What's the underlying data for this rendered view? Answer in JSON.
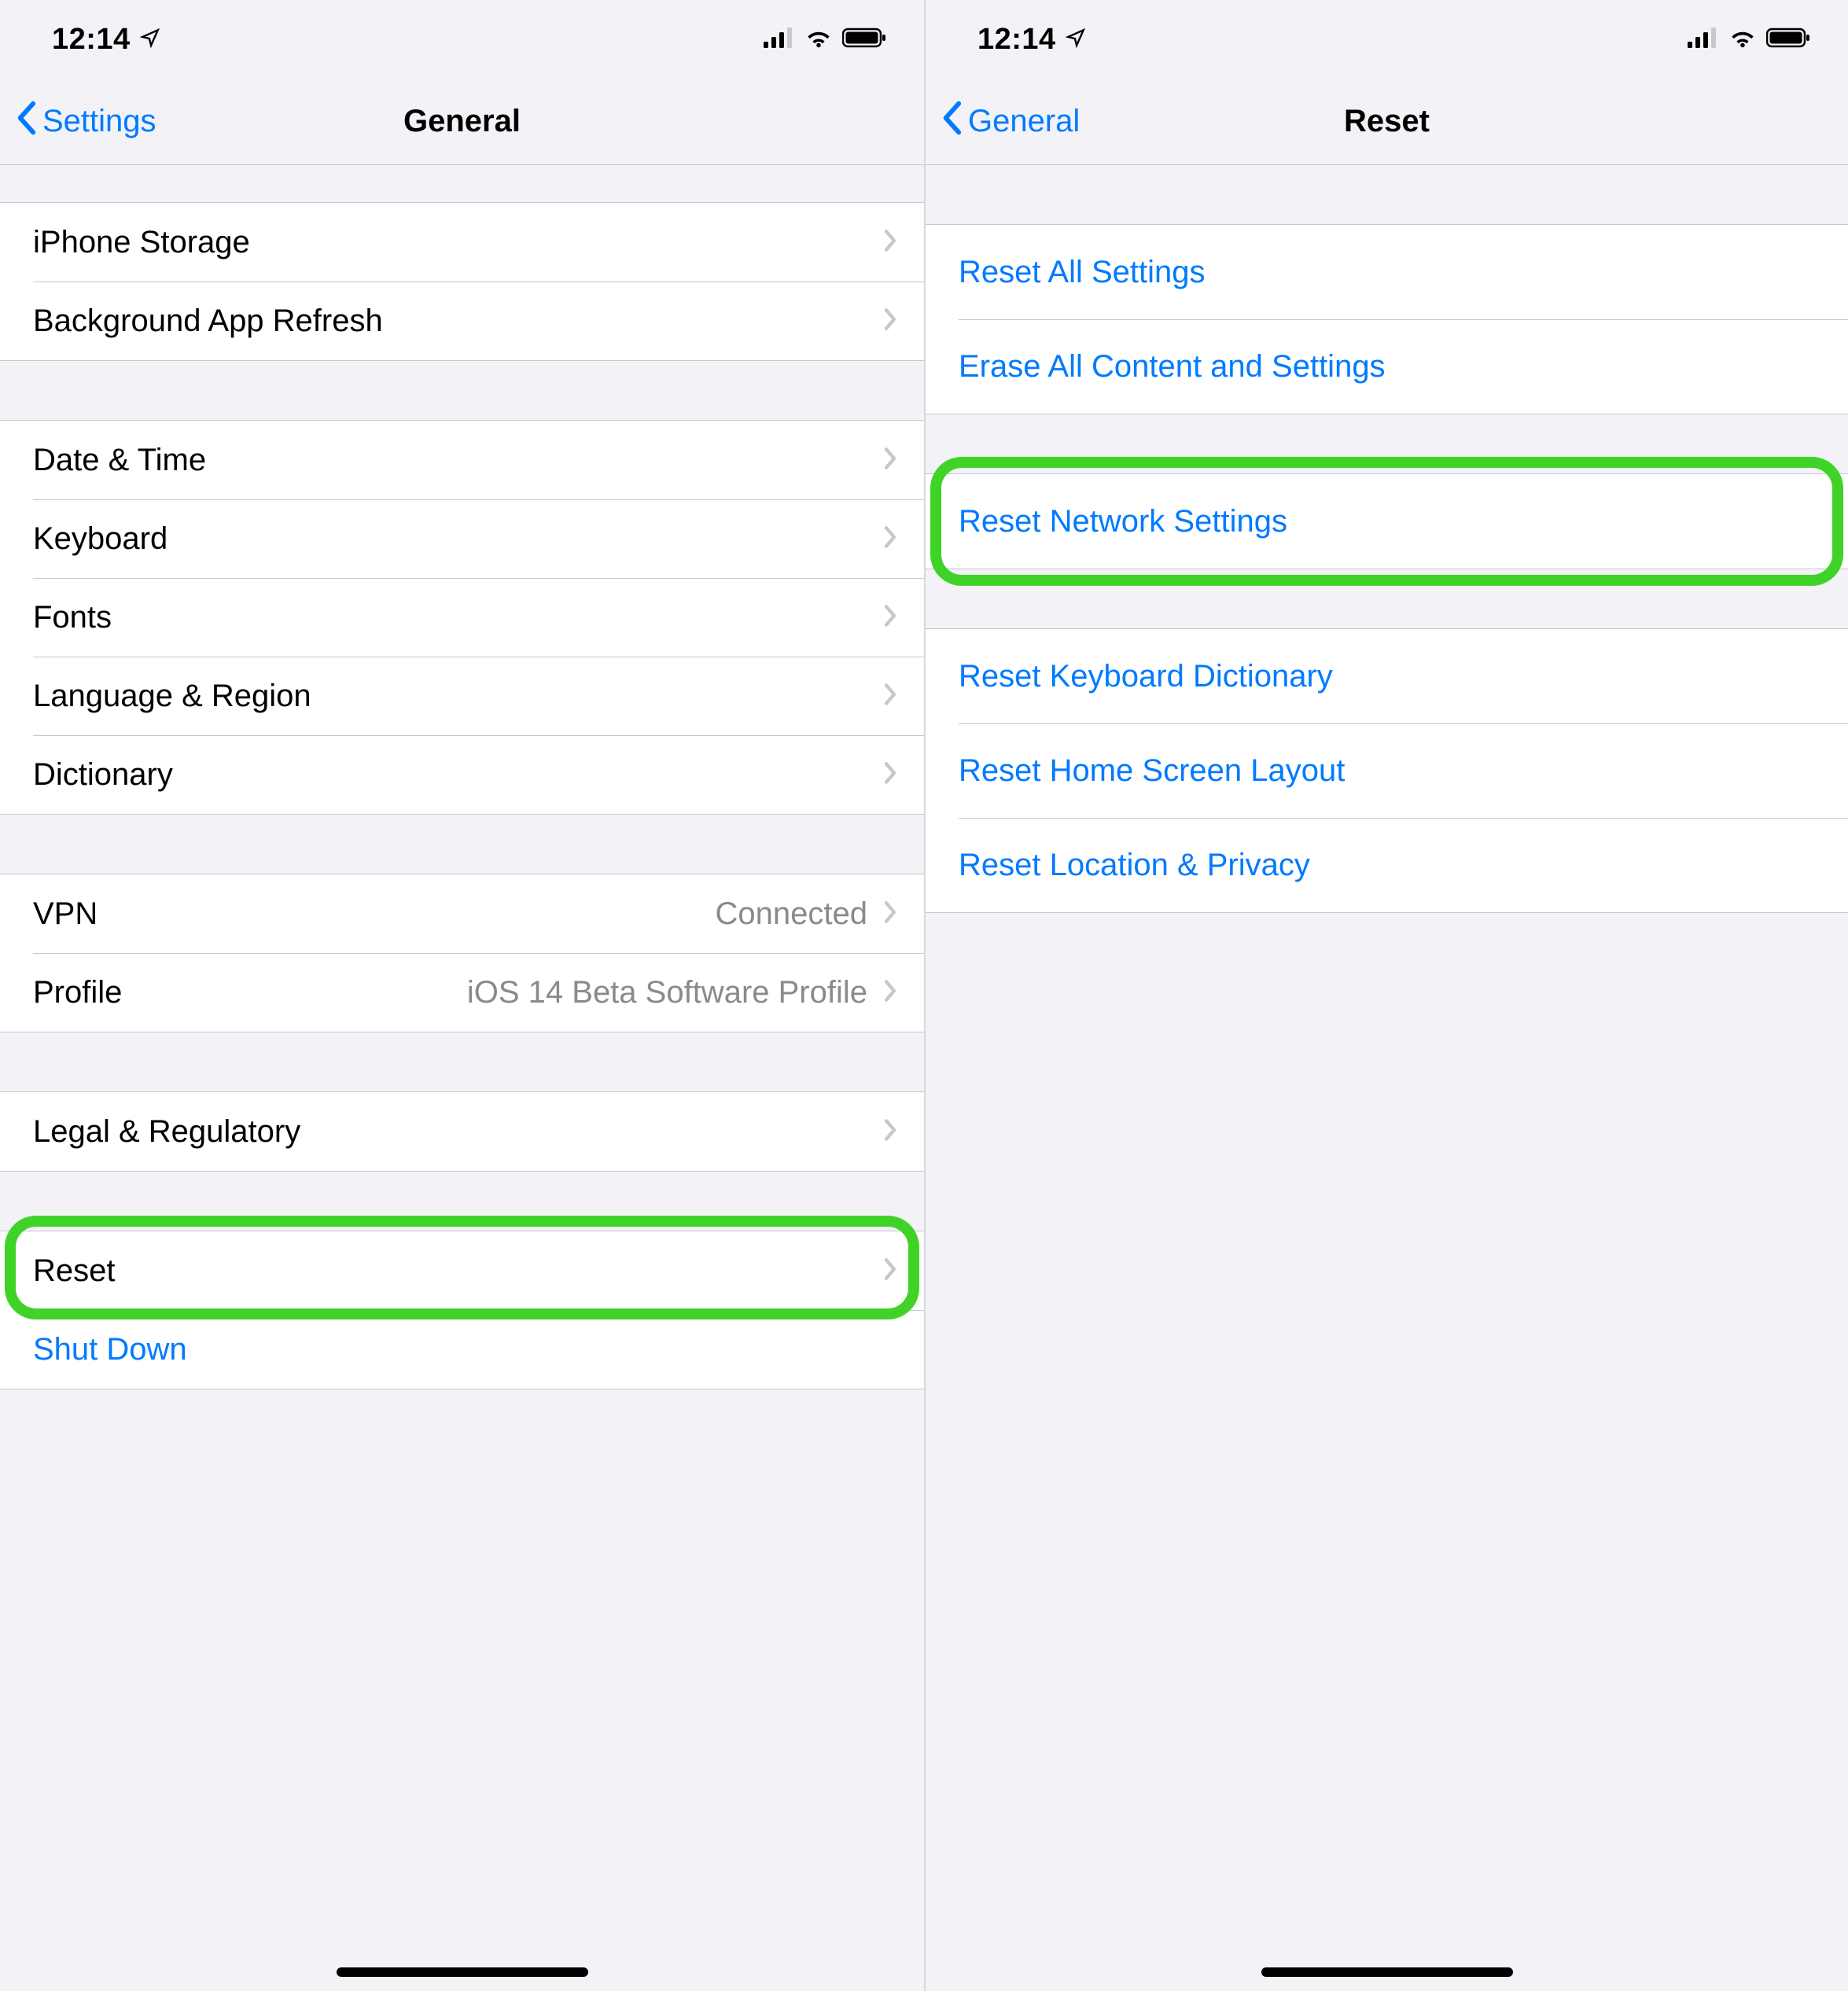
{
  "status": {
    "time": "12:14"
  },
  "left_screen": {
    "nav": {
      "back_label": "Settings",
      "title": "General"
    },
    "group1": [
      {
        "label": "iPhone Storage"
      },
      {
        "label": "Background App Refresh"
      }
    ],
    "group2": [
      {
        "label": "Date & Time"
      },
      {
        "label": "Keyboard"
      },
      {
        "label": "Fonts"
      },
      {
        "label": "Language & Region"
      },
      {
        "label": "Dictionary"
      }
    ],
    "group3": [
      {
        "label": "VPN",
        "detail": "Connected"
      },
      {
        "label": "Profile",
        "detail": "iOS 14 Beta Software Profile"
      }
    ],
    "group4": [
      {
        "label": "Legal & Regulatory"
      }
    ],
    "group5": [
      {
        "label": "Reset"
      },
      {
        "label": "Shut Down",
        "link": true,
        "no_chevron": true
      }
    ]
  },
  "right_screen": {
    "nav": {
      "back_label": "General",
      "title": "Reset"
    },
    "group1": [
      {
        "label": "Reset All Settings"
      },
      {
        "label": "Erase All Content and Settings"
      }
    ],
    "group2": [
      {
        "label": "Reset Network Settings"
      }
    ],
    "group3": [
      {
        "label": "Reset Keyboard Dictionary"
      },
      {
        "label": "Reset Home Screen Layout"
      },
      {
        "label": "Reset Location & Privacy"
      }
    ]
  }
}
